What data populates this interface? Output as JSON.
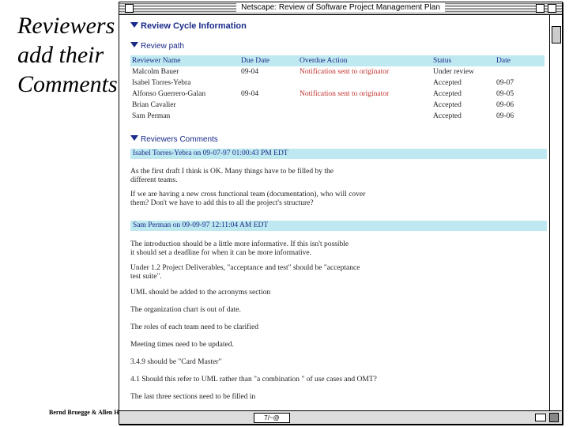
{
  "slide": {
    "title_lines": [
      "Reviewers",
      "add their",
      "Comments"
    ],
    "footer": "Bernd Bruegge & Allen H"
  },
  "window": {
    "title": "Netscape: Review of Software Project Management Plan",
    "status_badge": "7/~@"
  },
  "review_cycle": {
    "heading": "Review Cycle Information",
    "subheading": "Review path",
    "columns": [
      "Reviewer Name",
      "Due Date",
      "Overdue Action",
      "Status",
      "Date"
    ],
    "rows": [
      {
        "name": "Malcolm Bauer",
        "due": "09-04",
        "action": "Notification sent to originator",
        "status": "Under review",
        "date": ""
      },
      {
        "name": "Isabel Torres-Yebra",
        "due": "",
        "action": "",
        "status": "Accepted",
        "date": "09-07"
      },
      {
        "name": "Alfonso Guerrero-Galan",
        "due": "09-04",
        "action": "Notification sent to originator",
        "status": "Accepted",
        "date": "09-05"
      },
      {
        "name": "Brian Cavalier",
        "due": "",
        "action": "",
        "status": "Accepted",
        "date": "09-06"
      },
      {
        "name": "Sam Perman",
        "due": "",
        "action": "",
        "status": "Accepted",
        "date": "09-06"
      }
    ],
    "overdue_color": "#c0302a",
    "header_bg": "#bfe9f0"
  },
  "reviewers_comments": {
    "heading": "Reviewers Comments",
    "comments": [
      {
        "author": "Isabel Torres-Yebra on 09-07-97 01:00:43 PM EDT",
        "paragraphs": [
          "As the first draft I think is OK. Many things have to be filled by the\ndifferent teams.",
          "If we are having a new cross functional team (documentation), who will cover\nthem? Don't we have to add this to all the project's structure?"
        ]
      },
      {
        "author": "Sam Perman on 09-09-97 12:11:04 AM EDT",
        "paragraphs": [
          "The introduction should be a little more informative. If this isn't possible\nit should set a deadline for when it can be more informative.",
          "Under 1.2 Project Deliverables, \"acceptance and test\" should be \"acceptance\ntest suite\".",
          "UML should be added to the acronyms section",
          "The organization chart is out of date.",
          "The roles of each team need to be clarified",
          "Meeting times need to be updated.",
          "3.4.9 should be \"Card Master\"",
          "4.1 Should this refer to UML rather than \"a combination \" of use cases and OMT?",
          "The last three sections need to be filled in"
        ]
      }
    ]
  }
}
